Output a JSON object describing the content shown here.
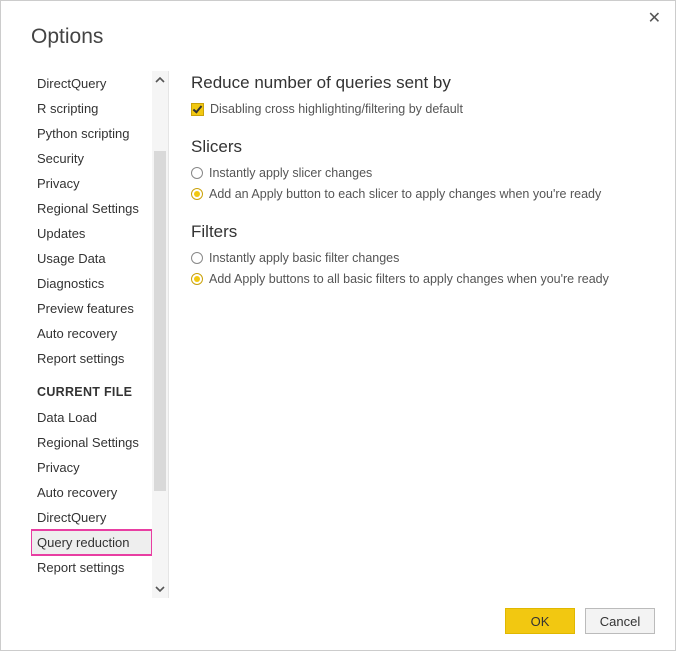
{
  "window_title": "Options",
  "sidebar": {
    "global_items": [
      "DirectQuery",
      "R scripting",
      "Python scripting",
      "Security",
      "Privacy",
      "Regional Settings",
      "Updates",
      "Usage Data",
      "Diagnostics",
      "Preview features",
      "Auto recovery",
      "Report settings"
    ],
    "current_header": "CURRENT FILE",
    "current_items": [
      "Data Load",
      "Regional Settings",
      "Privacy",
      "Auto recovery",
      "DirectQuery",
      "Query reduction",
      "Report settings"
    ],
    "selected": "Query reduction"
  },
  "content": {
    "heading_main": "Reduce number of queries sent by",
    "checkbox_label": "Disabling cross highlighting/filtering by default",
    "heading_slicers": "Slicers",
    "slicer_opt1": "Instantly apply slicer changes",
    "slicer_opt2": "Add an Apply button to each slicer to apply changes when you're ready",
    "heading_filters": "Filters",
    "filter_opt1": "Instantly apply basic filter changes",
    "filter_opt2": "Add Apply buttons to all basic filters to apply changes when you're ready"
  },
  "buttons": {
    "ok": "OK",
    "cancel": "Cancel"
  }
}
